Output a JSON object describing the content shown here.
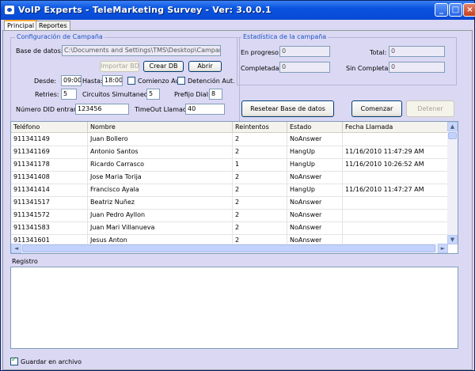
{
  "window": {
    "title": "VoIP Experts - TeleMarketing Survey - Ver: 3.0.0.1",
    "controls": [
      "_",
      "□",
      "×"
    ]
  },
  "tabs": [
    {
      "label": "Principal",
      "active": true
    },
    {
      "label": "Reportes",
      "active": false
    }
  ],
  "config": {
    "group_title": "Configuración de Campaña",
    "db_label": "Base de datos:",
    "db_path": "C:\\Documents and Settings\\TMS\\Desktop\\Campaña Tesa",
    "import_label": "Importar BD",
    "create_label": "Crear DB",
    "open_label": "Abrir",
    "desde_label": "Desde:",
    "desde_value": "09:00",
    "hasta_label": "Hasta:",
    "hasta_value": "18:00",
    "comienzo_label": "Comienzo Aut.",
    "comienzo_checked": false,
    "detencion_label": "Detención Aut.",
    "detencion_checked": false,
    "retries_label": "Retries:",
    "retries_value": "5",
    "circuitos_label": "Circuitos Simultaneos:",
    "circuitos_value": "5",
    "prefijo_label": "Prefijo Dial:",
    "prefijo_value": "8",
    "did_label": "Número DID entrante:",
    "did_value": "123456",
    "timeout_label": "TimeOut Llamada:",
    "timeout_value": "40"
  },
  "stats": {
    "group_title": "Estadística de la campaña",
    "progreso_label": "En progreso:",
    "progreso_value": "0",
    "total_label": "Total:",
    "total_value": "0",
    "completadas_label": "Completadas:",
    "completadas_value": "0",
    "sin_label": "Sin Completar:",
    "sin_value": "0"
  },
  "actions": {
    "reset_label": "Resetear Base de datos",
    "start_label": "Comenzar",
    "stop_label": "Detener"
  },
  "table": {
    "columns": [
      "Teléfono",
      "Nombre",
      "Reintentos",
      "Estado",
      "Fecha Llamada"
    ],
    "rows": [
      [
        "911341149",
        "Juan Bollero",
        "2",
        "NoAnswer",
        ""
      ],
      [
        "911341169",
        "Antonio Santos",
        "2",
        "HangUp",
        "11/16/2010 11:47:29 AM"
      ],
      [
        "911341178",
        "Ricardo Carrasco",
        "1",
        "HangUp",
        "11/16/2010 10:26:52 AM"
      ],
      [
        "911341408",
        "Jose Maria Torija",
        "2",
        "NoAnswer",
        ""
      ],
      [
        "911341414",
        "Francisco Ayala",
        "2",
        "HangUp",
        "11/16/2010 11:47:27 AM"
      ],
      [
        "911341517",
        "Beatriz Nuñez",
        "2",
        "NoAnswer",
        ""
      ],
      [
        "911341572",
        "Juan Pedro Ayllon",
        "2",
        "NoAnswer",
        ""
      ],
      [
        "911341583",
        "Juan Mari Villanueva",
        "2",
        "NoAnswer",
        ""
      ],
      [
        "911341601",
        "Jesus Anton",
        "2",
        "NoAnswer",
        ""
      ]
    ]
  },
  "log": {
    "label": "Registro"
  },
  "footer": {
    "save_label": "Guardar en archivo",
    "save_checked": true
  }
}
